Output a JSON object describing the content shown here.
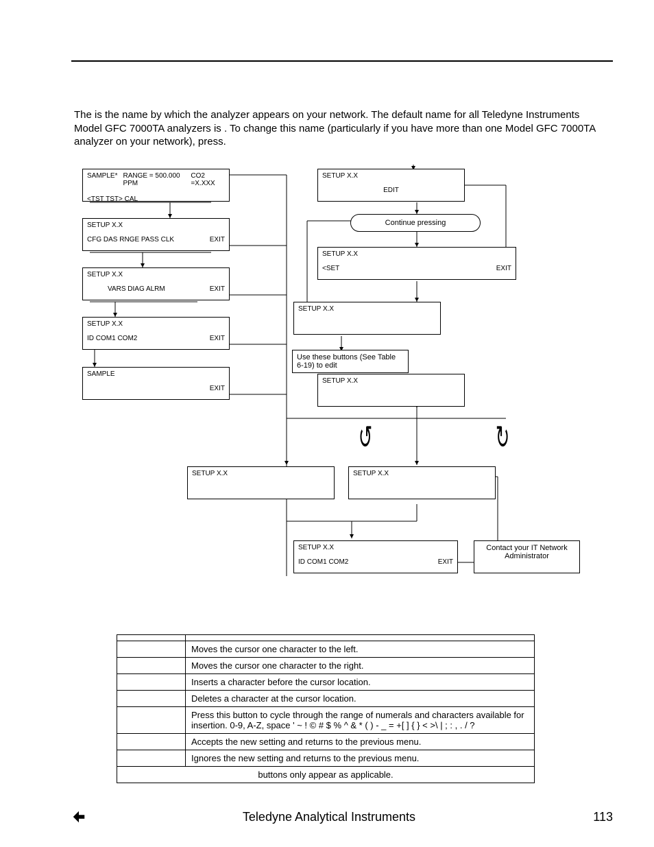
{
  "paragraph": {
    "p1a": "The ",
    "p1b": " is the name by which the analyzer appears on your network.  The default name for all Teledyne Instruments Model GFC 7000TA analyzers is ",
    "p1c": ".  To change this name (particularly if you have more than one Model GFC 7000TA analyzer on your network), press."
  },
  "flow": {
    "b1": {
      "l1": "SAMPLE*",
      "l2": "RANGE = 500.000 PPM",
      "l3": "CO2 =X.XXX",
      "l4": "<TST  TST>  CAL"
    },
    "b2": {
      "t": "SETUP X.X",
      "r": "CFG  DAS  RNGE  PASS  CLK",
      "exit": "EXIT"
    },
    "b3": {
      "t": "SETUP X.X",
      "r": "VARS  DIAG  ALRM",
      "exit": "EXIT"
    },
    "b4": {
      "t": "SETUP X.X",
      "r": "ID          COM1   COM2",
      "exit": "EXIT"
    },
    "b5": {
      "t": "SAMPLE",
      "exit": "EXIT"
    },
    "b6": {
      "t": "SETUP X.X",
      "r": "EDIT"
    },
    "r1": "Continue pressing",
    "b7": {
      "t": "SETUP X.X",
      "r": "<SET",
      "exit": "EXIT"
    },
    "b8": {
      "t": "SETUP X.X"
    },
    "note1": "Use these buttons (See Table 6-19) to edit",
    "b9": {
      "t": "SETUP X.X"
    },
    "b10": {
      "t": "SETUP X.X"
    },
    "b11": {
      "t": "SETUP X.X"
    },
    "b12": {
      "t": "SETUP X.X",
      "r": "ID               COM1    COM2",
      "exit": "EXIT"
    },
    "note2": "Contact your IT Network Administrator"
  },
  "table": {
    "rows": [
      {
        "desc": "Moves the cursor one character to the left."
      },
      {
        "desc": "Moves the cursor one character to the right."
      },
      {
        "desc": "Inserts a character before the cursor location."
      },
      {
        "desc": "Deletes a character at the cursor location."
      },
      {
        "desc": "Press this button to cycle through the range of numerals and characters available for insertion.  0-9, A-Z, space ' ~ ! © # $ % ^ & * ( ) - _ = +[ ] { } < >\\ | ; : , .  / ?"
      },
      {
        "desc": "Accepts the new setting and returns to the previous menu."
      },
      {
        "desc": "Ignores the new setting and returns to the previous menu."
      }
    ],
    "foot": " buttons only appear as applicable."
  },
  "footer": {
    "brand": "Teledyne Analytical Instruments",
    "page": "113"
  }
}
